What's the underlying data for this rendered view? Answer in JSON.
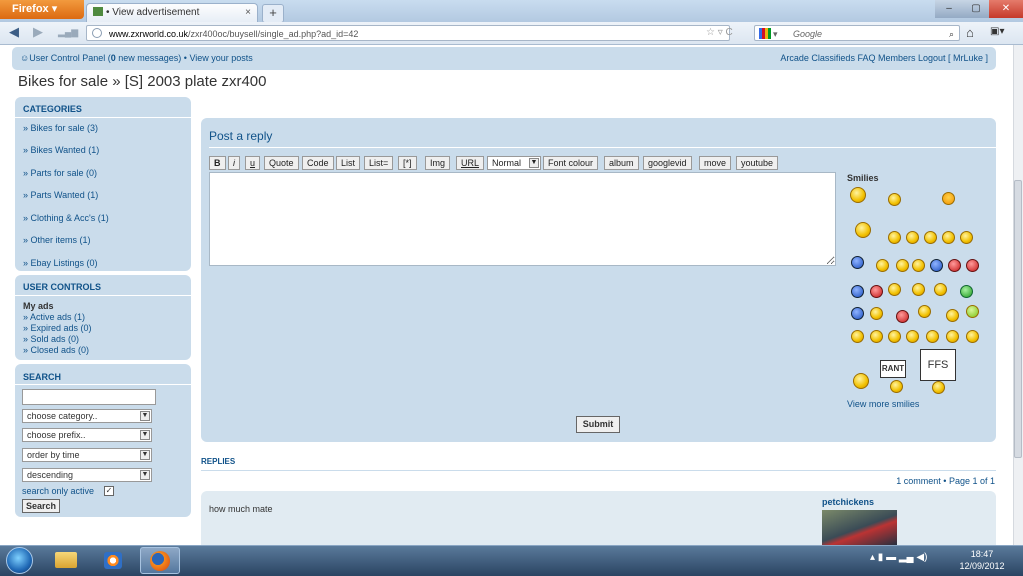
{
  "browser": {
    "app_button": "Firefox",
    "tab_title": "View advertisement",
    "tab_close": "×",
    "new_tab": "+",
    "url_domain": "www.zxrworld.co.uk",
    "url_path": "/zxr400oc/buysell/single_ad.php?ad_id=42",
    "url_right_icons": "☆ ▿ C",
    "search_placeholder": "Google",
    "window_min": "–",
    "window_max": "▢",
    "window_close": "✕"
  },
  "topbar": {
    "left_ucp": "User Control Panel (",
    "left_count": "0",
    "left_rest": " new messages) • View your posts",
    "right_links": "Arcade  Classifieds  FAQ  Members  Logout [ MrLuke ]"
  },
  "page_title": "Bikes for sale » [S] 2003 plate zxr400",
  "categories": {
    "heading": "CATEGORIES",
    "items": [
      "» Bikes for sale (3)",
      "» Bikes Wanted (1)",
      "» Parts for sale (0)",
      "» Parts Wanted (1)",
      "» Clothing & Acc's (1)",
      "» Other items (1)",
      "» Ebay Listings (0)"
    ]
  },
  "user_controls": {
    "heading": "USER CONTROLS",
    "subheading": "My ads",
    "items": [
      "» Active ads (1)",
      "» Expired ads (0)",
      "» Sold ads (0)",
      "» Closed ads (0)"
    ]
  },
  "search": {
    "heading": "SEARCH",
    "input_value": "",
    "category_select": "choose category..",
    "prefix_select": "choose prefix..",
    "order_select": "order by time",
    "direction_select": "descending",
    "only_active_label": "search only active",
    "only_active_checked": true,
    "button": "Search"
  },
  "post_reply": {
    "title": "Post a reply",
    "toolbar": [
      "B",
      "i",
      "u",
      "Quote",
      "Code",
      "List",
      "List=",
      "[*]",
      "Img",
      "URL",
      "Normal",
      "Font colour",
      "album",
      "googlevid",
      "move",
      "youtube"
    ],
    "textarea_value": "",
    "smilies_title": "Smilies",
    "view_more": "View more smilies",
    "rant_sign": "RANT",
    "ffs_sign": "FFS",
    "submit": "Submit"
  },
  "replies": {
    "heading": "REPLIES",
    "page_info": "1 comment • Page 1 of 1",
    "items": [
      {
        "text": "how much mate",
        "author": "petchickens"
      }
    ]
  },
  "taskbar": {
    "time": "18:47",
    "date": "12/09/2012"
  }
}
